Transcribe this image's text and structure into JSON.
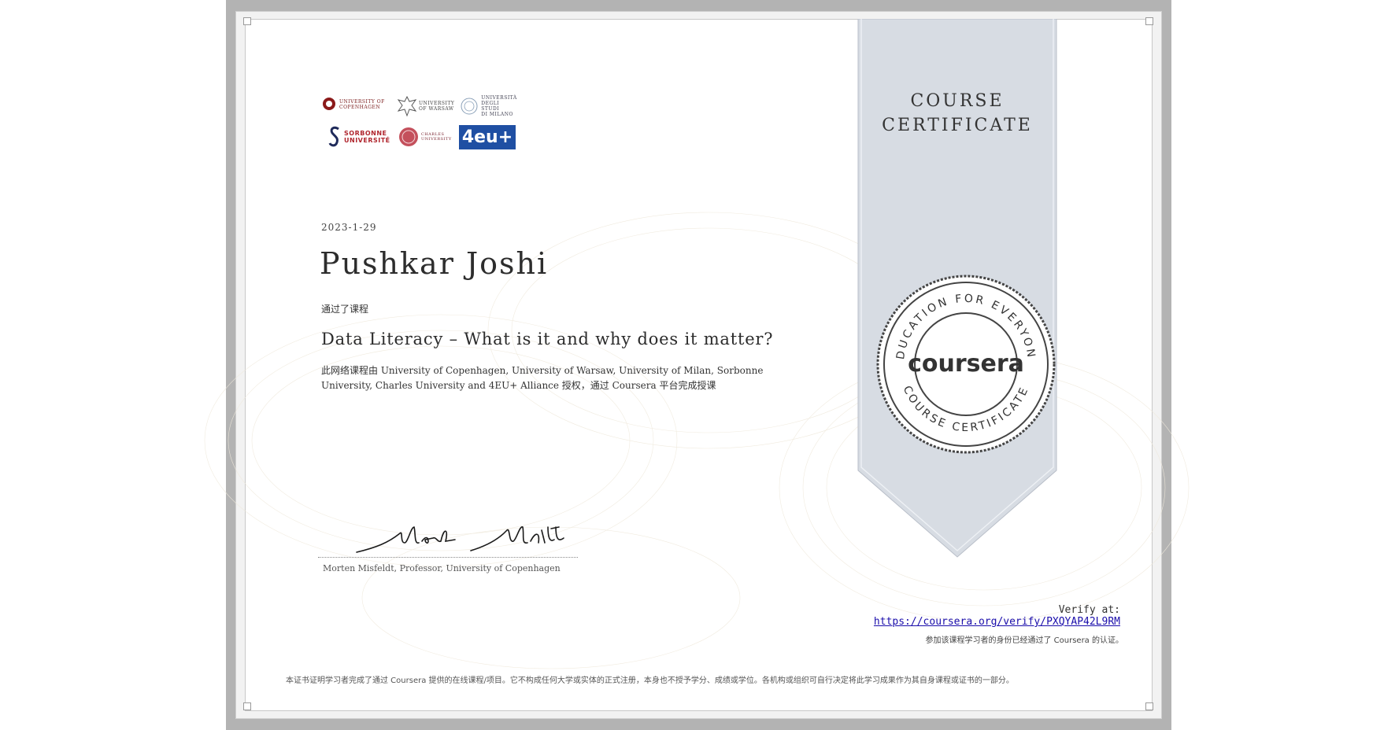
{
  "certificate": {
    "ribbon_title_line1": "COURSE",
    "ribbon_title_line2": "CERTIFICATE",
    "date": "2023-1-29",
    "recipient_name": "Pushkar Joshi",
    "completed_label": "通过了课程",
    "course_title": "Data Literacy – What is it and why does it matter?",
    "description": "此网络课程由 University of Copenhagen, University of Warsaw, University of Milan, Sorbonne University, Charles University and 4EU+ Alliance 授权，通过 Coursera 平台完成授课",
    "signer": "Morten Misfeldt, Professor, University of Copenhagen",
    "signature_text": "Morten Misfeldt"
  },
  "logos": {
    "copenhagen_line1": "UNIVERSITY OF",
    "copenhagen_line2": "COPENHAGEN",
    "warsaw_line1": "UNIVERSITY",
    "warsaw_line2": "OF WARSAW",
    "milan_line1": "UNIVERSITÀ",
    "milan_line2": "DEGLI STUDI",
    "milan_line3": "DI MILANO",
    "sorbonne_line1": "SORBONNE",
    "sorbonne_line2": "UNIVERSITÉ",
    "charles_line1": "CHARLES",
    "charles_line2": "UNIVERSITY",
    "alliance": "4eu+"
  },
  "seal": {
    "brand": "coursera",
    "ring_top": "EDUCATION FOR EVERYONE",
    "ring_bottom": "COURSE CERTIFICATE"
  },
  "verification": {
    "label": "Verify at:",
    "url": "https://coursera.org/verify/PXQYAP42L9RM",
    "note": "参加该课程学习者的身份已经通过了 Coursera 的认证。"
  },
  "disclaimer": "本证书证明学习者完成了通过 Coursera 提供的在线课程/项目。它不构成任何大学或实体的正式注册，本身也不授予学分、成绩或学位。各机构或组织可自行决定将此学习成果作为其自身课程或证书的一部分。",
  "colors": {
    "frame": "#b3b3b3",
    "ribbon": "#d7dce3",
    "link": "#1a0dab",
    "copenhagen_red": "#8b1a1a",
    "sorbonne_navy": "#1f2a5a",
    "alliance_blue": "#1f4fa3"
  }
}
